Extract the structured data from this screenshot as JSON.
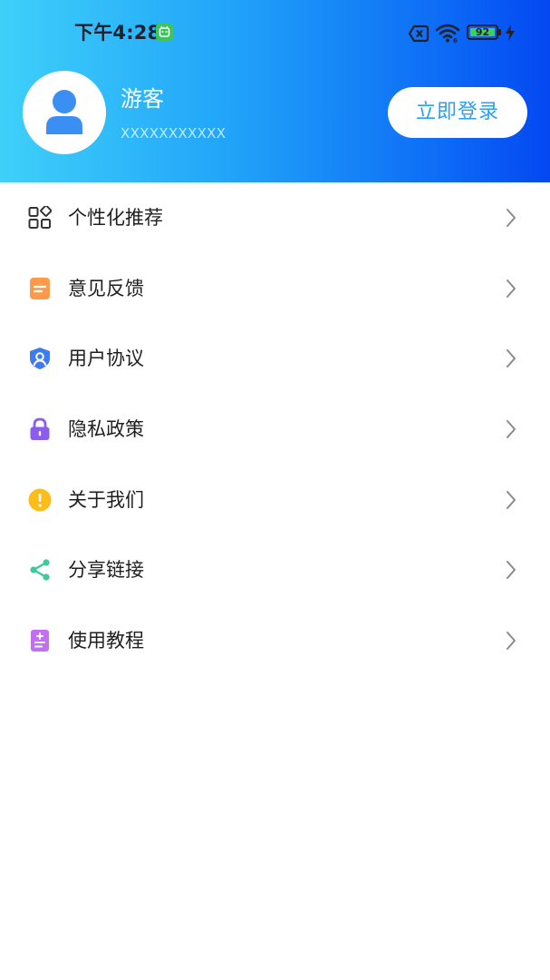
{
  "status_bar": {
    "time": "下午4:28",
    "battery_level": "92"
  },
  "profile": {
    "name": "游客",
    "user_id": "XXXXXXXXXXX",
    "login_button": "立即登录"
  },
  "menu": {
    "items": [
      {
        "label": "个性化推荐",
        "icon": "grid-icon"
      },
      {
        "label": "意见反馈",
        "icon": "feedback-icon"
      },
      {
        "label": "用户协议",
        "icon": "shield-user-icon"
      },
      {
        "label": "隐私政策",
        "icon": "lock-icon"
      },
      {
        "label": "关于我们",
        "icon": "info-exclamation-icon"
      },
      {
        "label": "分享链接",
        "icon": "share-icon"
      },
      {
        "label": "使用教程",
        "icon": "tutorial-icon"
      }
    ]
  },
  "colors": {
    "header_gradient_start": "#3fd0f9",
    "header_gradient_end": "#0447f1",
    "login_text": "#2a9ff5",
    "feedback_icon": "#ff9a4a",
    "shield_icon": "#3d7cf0",
    "lock_icon": "#8a5cf0",
    "info_icon": "#fcbd1a",
    "share_icon": "#3ec99a",
    "tutorial_icon": "#c46ff0"
  }
}
